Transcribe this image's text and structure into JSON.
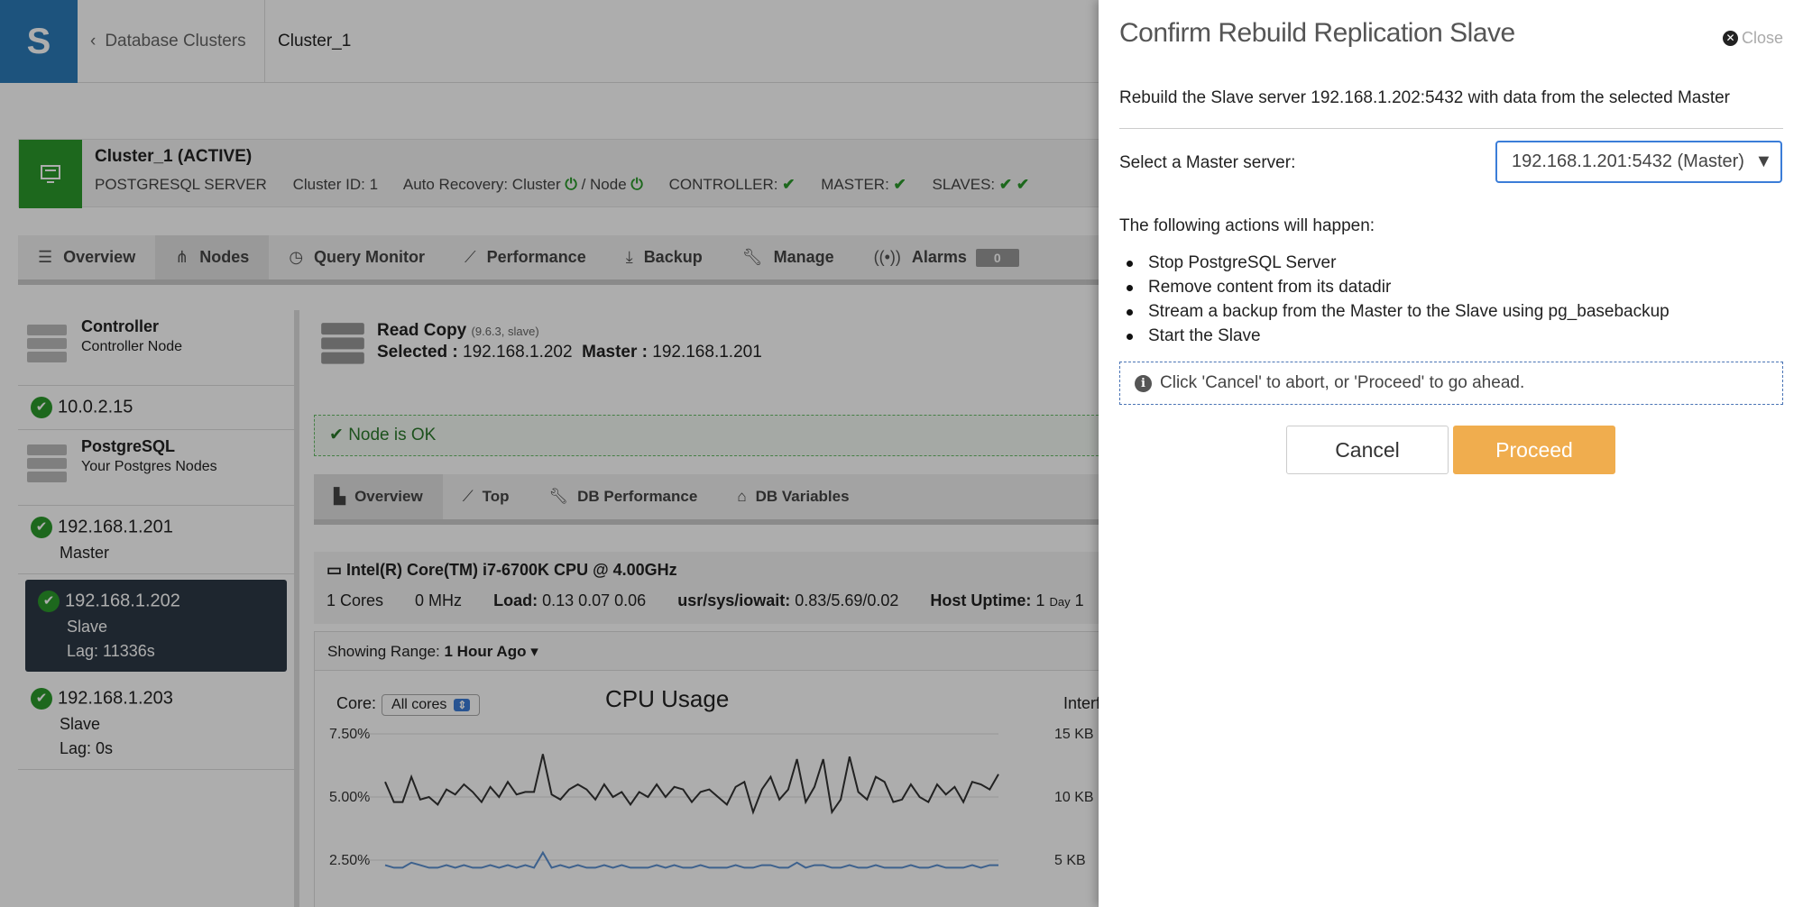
{
  "topbar": {
    "breadcrumb_back": "Database Clusters",
    "breadcrumb_current": "Cluster_1"
  },
  "cluster": {
    "name": "Cluster_1 (ACTIVE)",
    "type": "POSTGRESQL SERVER",
    "id": "Cluster ID: 1",
    "auto_recovery": "Auto Recovery: Cluster",
    "auto_recovery_node": "/ Node",
    "controller": "CONTROLLER:",
    "master": "MASTER:",
    "slaves": "SLAVES:"
  },
  "tabs": [
    {
      "label": "Overview",
      "icon": "list-icon"
    },
    {
      "label": "Nodes",
      "icon": "sitemap-icon"
    },
    {
      "label": "Query Monitor",
      "icon": "clock-icon"
    },
    {
      "label": "Performance",
      "icon": "line-chart-icon"
    },
    {
      "label": "Backup",
      "icon": "download-icon"
    },
    {
      "label": "Manage",
      "icon": "wrench-icon"
    },
    {
      "label": "Alarms",
      "icon": "broadcast-icon",
      "badge": "0"
    }
  ],
  "sidebar": {
    "controller": {
      "title": "Controller",
      "sub": "Controller Node"
    },
    "controller_ip": "10.0.2.15",
    "postgres": {
      "title": "PostgreSQL",
      "sub": "Your Postgres Nodes"
    },
    "nodes": [
      {
        "ip": "192.168.1.201",
        "role": "Master"
      },
      {
        "ip": "192.168.1.202",
        "role": "Slave",
        "lag": "Lag: 11336s"
      },
      {
        "ip": "192.168.1.203",
        "role": "Slave",
        "lag": "Lag: 0s"
      }
    ]
  },
  "detail": {
    "title": "Read Copy",
    "version": "(9.6.3, slave)",
    "selected_label": "Selected :",
    "selected": "192.168.1.202",
    "master_label": "Master :",
    "master": "192.168.1.201",
    "status": "Node is OK",
    "subtabs": [
      "Overview",
      "Top",
      "DB Performance",
      "DB Variables"
    ],
    "cpu_name": "Intel(R) Core(TM) i7-6700K CPU @ 4.00GHz",
    "cores": "1 Cores",
    "mhz": "0 MHz",
    "load_label": "Load:",
    "load": "0.13 0.07 0.06",
    "iowait_label": "usr/sys/iowait:",
    "iowait": "0.83/5.69/0.02",
    "uptime_label": "Host Uptime:",
    "uptime": "1",
    "uptime_unit": "Day",
    "uptime_tail": "1",
    "range_label": "Showing Range:",
    "range": "1 Hour Ago",
    "core_label": "Core:",
    "core_value": "All cores",
    "interface_label": "Interf"
  },
  "chart_data": {
    "type": "line",
    "title": "CPU Usage",
    "y_ticks": [
      "7.50%",
      "5.00%",
      "2.50%"
    ],
    "ylim": [
      2.5,
      7.5
    ],
    "series": [
      {
        "values": [
          5.6,
          4.8,
          4.8,
          5.8,
          4.9,
          5.0,
          4.7,
          5.3,
          5.1,
          5.5,
          5.2,
          4.8,
          5.4,
          5.0,
          5.6,
          5.1,
          5.2,
          5.2,
          6.7,
          5.1,
          4.9,
          5.3,
          5.5,
          5.3,
          4.9,
          5.5,
          5.0,
          5.2,
          4.7,
          5.2,
          5.0,
          5.5,
          5.0,
          5.4,
          5.3,
          4.8,
          5.2,
          5.3,
          5.0,
          4.7,
          5.4,
          5.6,
          4.4,
          5.3,
          5.8,
          4.9,
          5.3,
          6.5,
          4.8,
          5.4,
          6.5,
          4.4,
          4.9,
          6.6,
          5.2,
          4.9,
          5.8,
          5.6,
          4.8,
          4.9,
          5.5,
          5.0,
          4.8,
          5.5,
          5.1,
          5.4,
          4.8,
          5.6,
          5.5,
          5.3,
          5.9
        ],
        "color": "#333333"
      },
      {
        "values": [
          2.3,
          2.2,
          2.2,
          2.4,
          2.3,
          2.2,
          2.2,
          2.3,
          2.2,
          2.3,
          2.2,
          2.2,
          2.3,
          2.2,
          2.3,
          2.2,
          2.3,
          2.2,
          2.8,
          2.2,
          2.3,
          2.2,
          2.3,
          2.2,
          2.2,
          2.3,
          2.2,
          2.3,
          2.2,
          2.2,
          2.2,
          2.3,
          2.2,
          2.3,
          2.2,
          2.2,
          2.3,
          2.2,
          2.2,
          2.2,
          2.3,
          2.2,
          2.2,
          2.3,
          2.3,
          2.2,
          2.2,
          2.4,
          2.2,
          2.3,
          2.3,
          2.2,
          2.2,
          2.3,
          2.2,
          2.2,
          2.3,
          2.2,
          2.2,
          2.2,
          2.3,
          2.2,
          2.2,
          2.3,
          2.2,
          2.2,
          2.2,
          2.3,
          2.2,
          2.3,
          2.3
        ],
        "color": "#5a8fd0"
      }
    ],
    "right_ticks": [
      "15 KB",
      "10 KB",
      "5 KB"
    ]
  },
  "modal": {
    "title": "Confirm Rebuild Replication Slave",
    "close": "Close",
    "description": "Rebuild the Slave server 192.168.1.202:5432 with data from the selected Master",
    "select_label": "Select a Master server:",
    "select_value": "192.168.1.201:5432 (Master)",
    "actions_heading": "The following actions will happen:",
    "actions": [
      "Stop PostgreSQL Server",
      "Remove content from its datadir",
      "Stream a backup from the Master to the Slave using pg_basebackup",
      "Start the Slave"
    ],
    "info": "Click 'Cancel' to abort, or 'Proceed' to go ahead.",
    "cancel": "Cancel",
    "proceed": "Proceed"
  }
}
